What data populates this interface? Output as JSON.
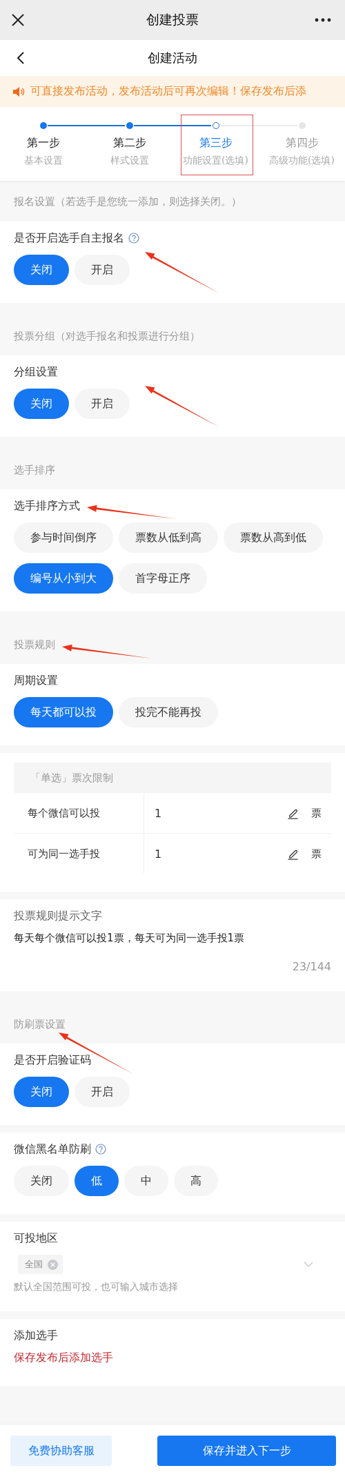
{
  "window": {
    "title": "创建投票"
  },
  "page": {
    "title": "创建活动"
  },
  "notice": "可直接发布活动，发布活动后可再次编辑！保存发布后添",
  "steps": [
    {
      "title": "第一步",
      "subtitle": "基本设置",
      "completed": true,
      "selected": false,
      "highlighted": false
    },
    {
      "title": "第二步",
      "subtitle": "样式设置",
      "completed": true,
      "selected": false,
      "highlighted": false
    },
    {
      "title": "第三步",
      "subtitle": "功能设置(选填)",
      "completed": false,
      "selected": true,
      "highlighted": true
    },
    {
      "title": "第四步",
      "subtitle": "高级功能(选填)",
      "completed": false,
      "selected": false,
      "highlighted": false
    }
  ],
  "blocks": [
    {
      "kind": "heading",
      "text": "报名设置（若选手是您统一添加，则选择关闭。）"
    },
    {
      "kind": "choice",
      "label": "是否开启选手自主报名",
      "help": true,
      "arrow": {
        "kind": "steep"
      },
      "options": [
        {
          "label": "关闭",
          "selected": true
        },
        {
          "label": "开启",
          "selected": false
        }
      ]
    },
    {
      "kind": "heading",
      "text": "投票分组（对选手报名和投票进行分组）"
    },
    {
      "kind": "choice",
      "label": "分组设置",
      "help": false,
      "arrow": {
        "kind": "steep"
      },
      "options": [
        {
          "label": "关闭",
          "selected": true
        },
        {
          "label": "开启",
          "selected": false
        }
      ]
    },
    {
      "kind": "heading",
      "text": "选手排序"
    },
    {
      "kind": "choice",
      "label": "选手排序方式",
      "help": false,
      "arrow": {
        "kind": "shallow"
      },
      "options": [
        {
          "label": "参与时间倒序",
          "selected": false
        },
        {
          "label": "票数从低到高",
          "selected": false
        },
        {
          "label": "票数从高到低",
          "selected": false
        },
        {
          "label": "编号从小到大",
          "selected": true
        },
        {
          "label": "首字母正序",
          "selected": false
        }
      ]
    },
    {
      "kind": "heading",
      "text": "投票规则",
      "arrow": {
        "kind": "shallow"
      }
    },
    {
      "kind": "choice",
      "label": "周期设置",
      "help": false,
      "options": [
        {
          "label": "每天都可以投",
          "selected": true
        },
        {
          "label": "投完不能再投",
          "selected": false
        }
      ]
    },
    {
      "kind": "limits",
      "title": "「单选」票次限制",
      "rows": [
        {
          "label": "每个微信可以投",
          "value": "1",
          "unit": "票"
        },
        {
          "label": "可为同一选手投",
          "value": "1",
          "unit": "票"
        }
      ]
    },
    {
      "kind": "textarea",
      "label": "投票规则提示文字",
      "value": "每天每个微信可以投1票，每天可为同一选手投1票",
      "counter": "23/144"
    },
    {
      "kind": "heading",
      "text": "防刷票设置",
      "arrow": {
        "kind": "steep"
      }
    },
    {
      "kind": "choice",
      "label": "是否开启验证码",
      "help": false,
      "options": [
        {
          "label": "关闭",
          "selected": true
        },
        {
          "label": "开启",
          "selected": false
        }
      ]
    },
    {
      "kind": "choice",
      "label": "微信黑名单防刷",
      "help": true,
      "options": [
        {
          "label": "关闭",
          "selected": false
        },
        {
          "label": "低",
          "selected": true
        },
        {
          "label": "中",
          "selected": false
        },
        {
          "label": "高",
          "selected": false
        }
      ]
    },
    {
      "kind": "region",
      "label": "可投地区",
      "tags": [
        "全国"
      ],
      "hint": "默认全国范围可投，也可输入城市选择"
    },
    {
      "kind": "link",
      "label": "添加选手",
      "link": "保存发布后添加选手"
    }
  ],
  "footer": [
    {
      "label": "免费协助客服",
      "kind": "secondary"
    },
    {
      "label": "保存并进入下一步",
      "kind": "primary"
    }
  ]
}
